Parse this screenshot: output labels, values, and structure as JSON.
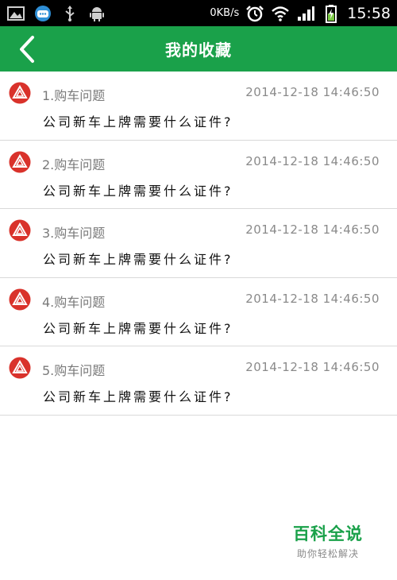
{
  "status_bar": {
    "icons_left": [
      "gallery-icon",
      "chat-app-icon",
      "usb-icon",
      "android-icon"
    ],
    "net_speed": "0KB/s",
    "icons_right": [
      "alarm-icon",
      "wifi-icon",
      "signal-icon",
      "battery-charging-icon"
    ],
    "time": "15:58"
  },
  "header": {
    "title": "我的收藏",
    "back_icon": "chevron-left-icon",
    "background_color": "#1aa14a"
  },
  "favorites": [
    {
      "category": "1.购车问题",
      "date": "2014-12-18  14:46:50",
      "question": "公司新车上牌需要什么证件?"
    },
    {
      "category": "2.购车问题",
      "date": "2014-12-18  14:46:50",
      "question": "公司新车上牌需要什么证件?"
    },
    {
      "category": "3.购车问题",
      "date": "2014-12-18  14:46:50",
      "question": "公司新车上牌需要什么证件?"
    },
    {
      "category": "4.购车问题",
      "date": "2014-12-18  14:46:50",
      "question": "公司新车上牌需要什么证件?"
    },
    {
      "category": "5.购车问题",
      "date": "2014-12-18  14:46:50",
      "question": "公司新车上牌需要什么证件?"
    }
  ],
  "watermark": {
    "main": "百科全说",
    "sub": "助你轻松解决"
  }
}
